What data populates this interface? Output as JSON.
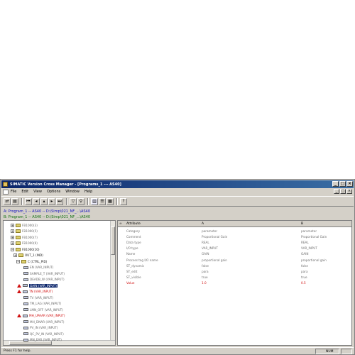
{
  "window": {
    "title": "SIMATIC Version Cross Manager - [Programs_1 --- AS40]",
    "controls": [
      "_",
      "□",
      "×"
    ]
  },
  "menu": {
    "items": [
      "File",
      "Edit",
      "View",
      "Options",
      "Window",
      "Help"
    ],
    "mdi_controls": [
      "_",
      "□",
      "×"
    ]
  },
  "paths": {
    "a": "A: Program_1 -- AS40 -- D:\\Simp\\021_NF_...\\AS40",
    "b": "B: Program_1 -- AS40 -- D:\\Simp\\021_NF_...\\AS40"
  },
  "tree": {
    "items": [
      {
        "label": "FB1000(3)"
      },
      {
        "label": "FB1000(5)"
      },
      {
        "label": "FB1000(7)"
      },
      {
        "label": "FB1000(9)"
      },
      {
        "label": "FB1000(10)"
      },
      {
        "label": "OUT_1 (IND)"
      },
      {
        "label": "C (CTRL_PID)"
      },
      {
        "label": "EN (VAR_INPUT)"
      },
      {
        "label": "SAMPLE_T (VAR_INPUT)"
      },
      {
        "label": "DEADB_W (VAR_INPUT)"
      },
      {
        "label": "GAIN (VAR_INPUT)"
      },
      {
        "label": "TN (VAR_INPUT)"
      },
      {
        "label": "TV (VAR_INPUT)"
      },
      {
        "label": "TM_LAG (VAR_INPUT)"
      },
      {
        "label": "LMN_OFF (VAR_INPUT)"
      },
      {
        "label": "MH_UPAAR (VAR_INPUT)"
      },
      {
        "label": "MH_DNAR (VAR_INPUT)"
      },
      {
        "label": "PV_IN (VAR_INPUT)"
      },
      {
        "label": "QC_PV_IN (VAR_INPUT)"
      },
      {
        "label": "MN_EAR (VAR_INPUT)"
      }
    ]
  },
  "grid": {
    "headers": [
      "Attribute",
      "A",
      "B"
    ],
    "rows": [
      [
        "Category",
        "parameter",
        "parameter"
      ],
      [
        "Comment",
        "Proportional Gain",
        "Proportional Gain"
      ],
      [
        "Data type",
        "REAL",
        "REAL"
      ],
      [
        "I/O type",
        "VAR_INPUT",
        "VAR_INPUT"
      ],
      [
        "Name",
        "GAIN",
        "GAIN"
      ],
      [
        "Process tag I/O name",
        "proportional gain",
        "proportional gain"
      ],
      [
        "ST_dynamic",
        "false",
        "false"
      ],
      [
        "ST_edit",
        "para",
        "para"
      ],
      [
        "ST_visible",
        "true",
        "true"
      ],
      [
        "Value",
        "1.0",
        "0.5"
      ]
    ]
  },
  "status": {
    "text": "Press F1 for help.",
    "num": "NUM"
  },
  "colors": {
    "title_start": "#0a246a",
    "title_end": "#3a6ea5",
    "diff": "#d01010",
    "path_a": "#1010c0",
    "path_b": "#107010"
  }
}
